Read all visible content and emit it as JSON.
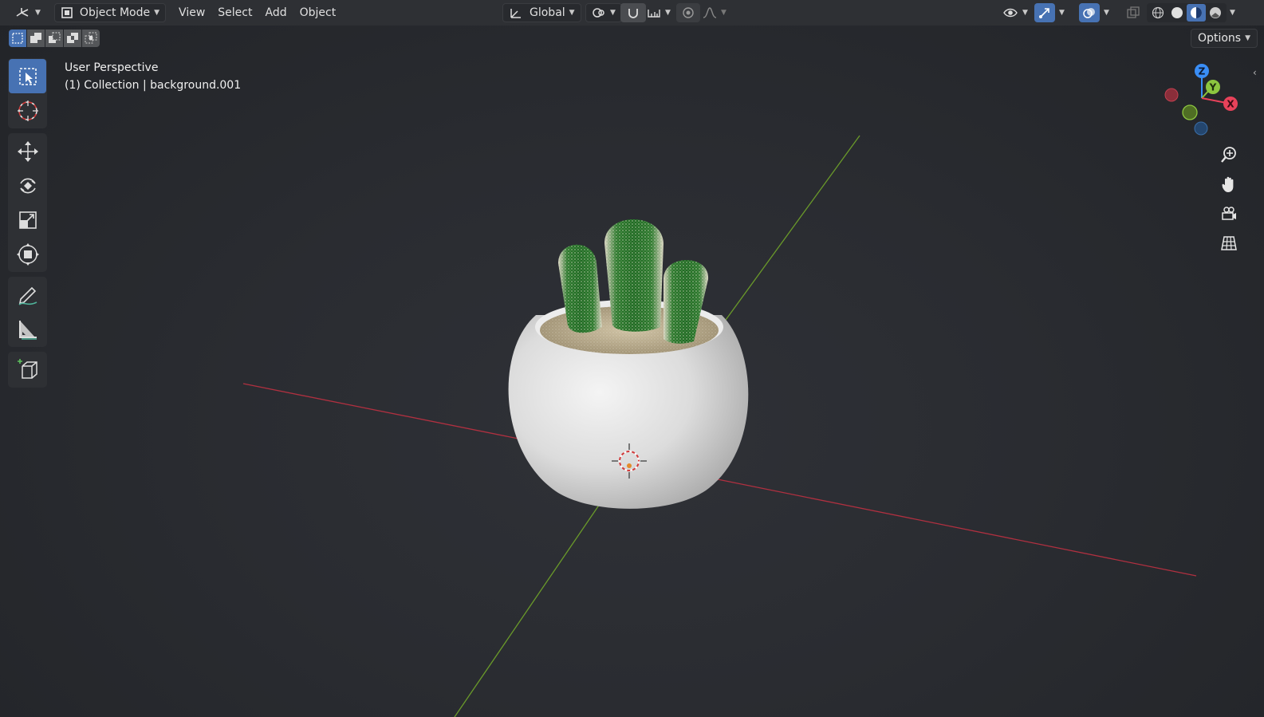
{
  "header": {
    "editor_type_icon": "3d-viewport-icon",
    "mode": {
      "label": "Object Mode",
      "icon": "object-mode-icon"
    },
    "menus": [
      "View",
      "Select",
      "Add",
      "Object"
    ],
    "transform_orientation": {
      "label": "Global",
      "icon": "orientation-icon"
    },
    "pivot_icon": "pivot-point-icon",
    "snap_icon": "snap-magnet-icon",
    "snap_target_icon": "snap-increment-icon",
    "proportional_icon": "proportional-edit-icon",
    "falloff_icon": "falloff-curve-icon",
    "visibility_icon": "eye-icon",
    "gizmo_toggle_icon": "gizmo-icon",
    "overlay_toggle_icon": "overlays-icon",
    "xray_icon": "xray-icon",
    "shading_modes": [
      "wireframe",
      "solid",
      "material-preview",
      "rendered"
    ],
    "active_shading": "material-preview"
  },
  "subheader": {
    "selection_modes": [
      "set-new",
      "extend",
      "subtract",
      "invert",
      "intersect"
    ],
    "options_label": "Options"
  },
  "toolbar": {
    "groups": [
      [
        "select-box",
        "cursor"
      ],
      [
        "move",
        "rotate",
        "scale",
        "transform"
      ],
      [
        "annotate",
        "measure"
      ],
      [
        "add-cube"
      ]
    ],
    "active_tool": "select-box"
  },
  "viewport": {
    "view_name": "User Perspective",
    "collection_line": "(1) Collection | background.001"
  },
  "gizmo": {
    "axes": [
      "Z",
      "Y",
      "X"
    ],
    "colors": {
      "x": "#e8425a",
      "y": "#8cc63f",
      "z": "#3a8ef6"
    }
  },
  "nav_buttons": [
    "zoom-icon",
    "hand-pan-icon",
    "camera-icon",
    "grid-ortho-icon"
  ],
  "colors": {
    "accent": "#4772b3",
    "x_axis_line": "#b03040",
    "y_axis_line": "#6a9a2a",
    "background": "#2b2d31"
  }
}
